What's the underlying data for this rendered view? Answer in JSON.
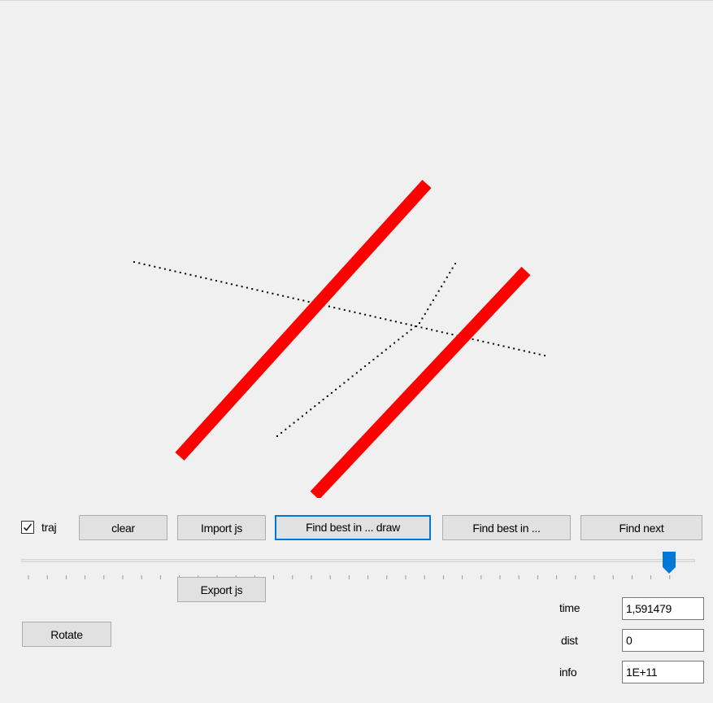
{
  "toolbar": {
    "traj_label": "traj",
    "traj_checked": true,
    "clear_label": "clear",
    "import_label": "Import js",
    "find_best_draw_label": "Find best in ... draw",
    "find_best_label": "Find best in ...",
    "find_next_label": "Find next"
  },
  "slider": {
    "value_fraction": 0.96
  },
  "export_label": "Export js",
  "rotate_label": "Rotate",
  "fields": {
    "time_label": "time",
    "time_value": "1,591479",
    "dist_label": "dist",
    "dist_value": "0",
    "info_label": "info",
    "info_value": "1E+11"
  },
  "colors": {
    "background": "#f0f0f0",
    "segment": "#ff0000",
    "trajectory": "#000000",
    "accent": "#0078d7"
  }
}
